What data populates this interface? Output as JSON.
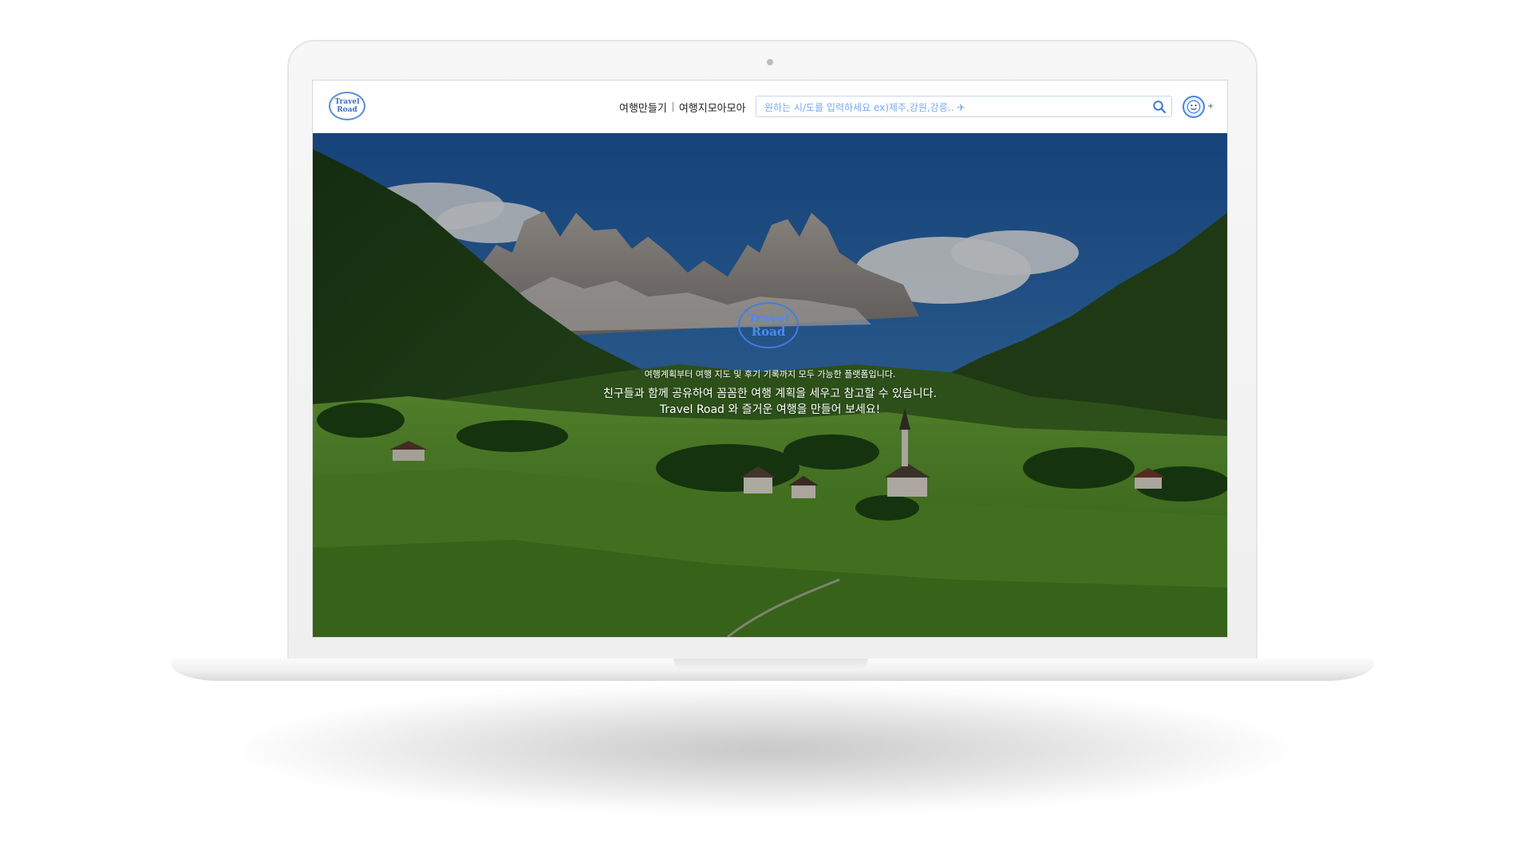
{
  "header": {
    "logo_line1": "Travel",
    "logo_line2": "Road",
    "nav": [
      {
        "label": "여행만들기"
      },
      {
        "label": "여행지모아모아"
      }
    ],
    "search": {
      "placeholder": "원하는 시/도를 입력하세요 ex)제주,강원,강릉.. ✈",
      "value": ""
    },
    "avatar_caret": "+"
  },
  "hero": {
    "logo_line1": "Travel",
    "logo_line2": "Road",
    "line1": "여행계획부터 여행 지도 및 후기 기록까지 모두 가능한 플랫폼입니다.",
    "line2": "친구들과 함께 공유하여 꼼꼼한 여행 계획을 세우고 참고할 수 있습니다.",
    "line3": "Travel Road 와 즐거운 여행을 만들어 보세요!"
  },
  "colors": {
    "brand": "#3f7fe0",
    "placeholder": "#7aa8e8"
  },
  "icons": {
    "search": "search-icon",
    "avatar": "smiley-avatar-icon"
  }
}
